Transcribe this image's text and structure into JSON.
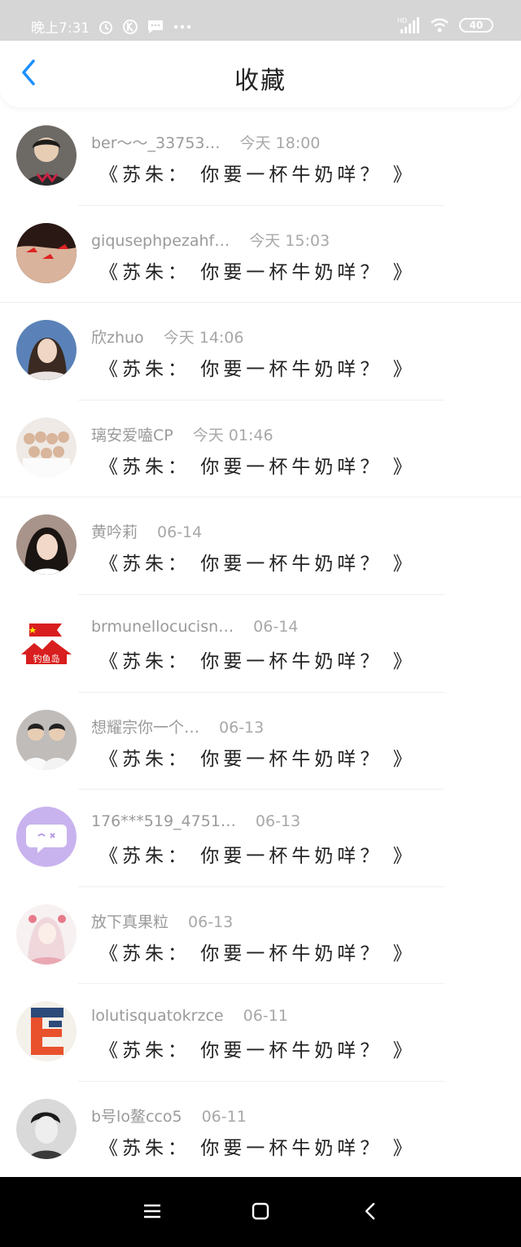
{
  "status_bar": {
    "time": "晚上7:31",
    "battery": "40",
    "icons": [
      "alarm-icon",
      "k-icon",
      "message-icon",
      "more-icon",
      "hd-signal-icon",
      "wifi-icon",
      "battery-icon"
    ]
  },
  "header": {
    "title": "收藏",
    "back_icon": "chevron-left-icon",
    "accent_color": "#1e90ff"
  },
  "items": [
    {
      "name": "ber～～_33753…",
      "time": "今天 18:00",
      "content": "《苏朱： 你要一杯牛奶咩？ 》"
    },
    {
      "name": "giqusephpezahf…",
      "time": "今天 15:03",
      "content": "《苏朱： 你要一杯牛奶咩？ 》"
    },
    {
      "name": "欣zhuo",
      "time": "今天 14:06",
      "content": "《苏朱： 你要一杯牛奶咩？ 》"
    },
    {
      "name": "璃安爱嗑CP",
      "time": "今天 01:46",
      "content": "《苏朱： 你要一杯牛奶咩？ 》"
    },
    {
      "name": "黄吟莉",
      "time": "06-14",
      "content": "《苏朱： 你要一杯牛奶咩？ 》"
    },
    {
      "name": "brmunellocucisn…",
      "time": "06-14",
      "content": "《苏朱： 你要一杯牛奶咩？ 》"
    },
    {
      "name": "想耀宗你一个…",
      "time": "06-13",
      "content": "《苏朱： 你要一杯牛奶咩？ 》"
    },
    {
      "name": "176***519_4751…",
      "time": "06-13",
      "content": "《苏朱： 你要一杯牛奶咩？ 》"
    },
    {
      "name": "放下真果粒",
      "time": "06-13",
      "content": "《苏朱： 你要一杯牛奶咩？ 》"
    },
    {
      "name": "lolutisquatokrzce",
      "time": "06-11",
      "content": "《苏朱： 你要一杯牛奶咩？ 》"
    },
    {
      "name": "b号lo鳌cco5",
      "time": "06-11",
      "content": "《苏朱： 你要一杯牛奶咩？ 》"
    }
  ],
  "avatar_badge_text": "钓鱼岛",
  "nav_bar": {
    "icons": [
      "menu-icon",
      "home-icon",
      "back-icon"
    ]
  }
}
